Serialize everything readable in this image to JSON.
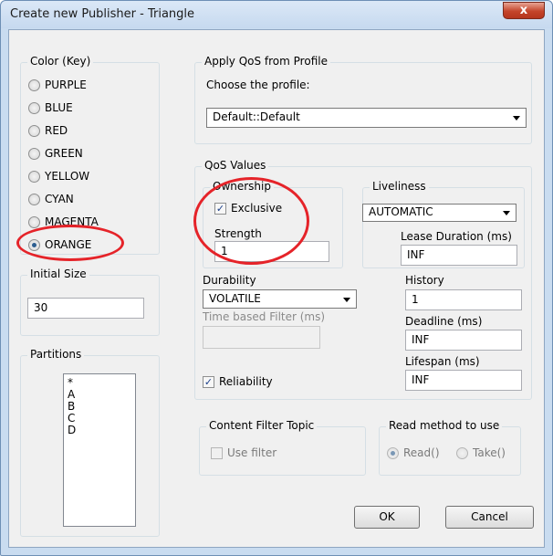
{
  "window": {
    "title": "Create new Publisher - Triangle",
    "close_label": "x"
  },
  "color_group": {
    "legend": "Color (Key)",
    "options": [
      "PURPLE",
      "BLUE",
      "RED",
      "GREEN",
      "YELLOW",
      "CYAN",
      "MAGENTA",
      "ORANGE"
    ],
    "selected": "ORANGE"
  },
  "initial_size": {
    "legend": "Initial Size",
    "value": "30"
  },
  "partitions": {
    "legend": "Partitions",
    "items": [
      "*",
      "A",
      "B",
      "C",
      "D"
    ]
  },
  "qos_profile": {
    "legend": "Apply QoS from Profile",
    "choose_label": "Choose the profile:",
    "selected": "Default::Default"
  },
  "qos_values": {
    "legend": "QoS Values",
    "ownership": {
      "legend": "Ownership",
      "exclusive_label": "Exclusive",
      "exclusive_checked": true,
      "strength_label": "Strength",
      "strength_value": "1"
    },
    "liveliness": {
      "legend": "Liveliness",
      "selected": "AUTOMATIC",
      "lease_label": "Lease Duration (ms)",
      "lease_value": "INF"
    },
    "durability": {
      "label": "Durability",
      "selected": "VOLATILE"
    },
    "time_filter": {
      "label": "Time based Filter (ms)",
      "value": ""
    },
    "history": {
      "label": "History",
      "value": "1"
    },
    "deadline": {
      "label": "Deadline (ms)",
      "value": "INF"
    },
    "lifespan": {
      "label": "Lifespan (ms)",
      "value": "INF"
    },
    "reliability": {
      "label": "Reliability",
      "checked": true
    }
  },
  "content_filter": {
    "legend": "Content Filter Topic",
    "use_filter_label": "Use filter"
  },
  "read_method": {
    "legend": "Read method to use",
    "read_label": "Read()",
    "take_label": "Take()"
  },
  "buttons": {
    "ok": "OK",
    "cancel": "Cancel"
  },
  "colors": {
    "highlight_ring": "#e52329",
    "titlebar": "#c9dcf0",
    "close": "#c4442a"
  }
}
